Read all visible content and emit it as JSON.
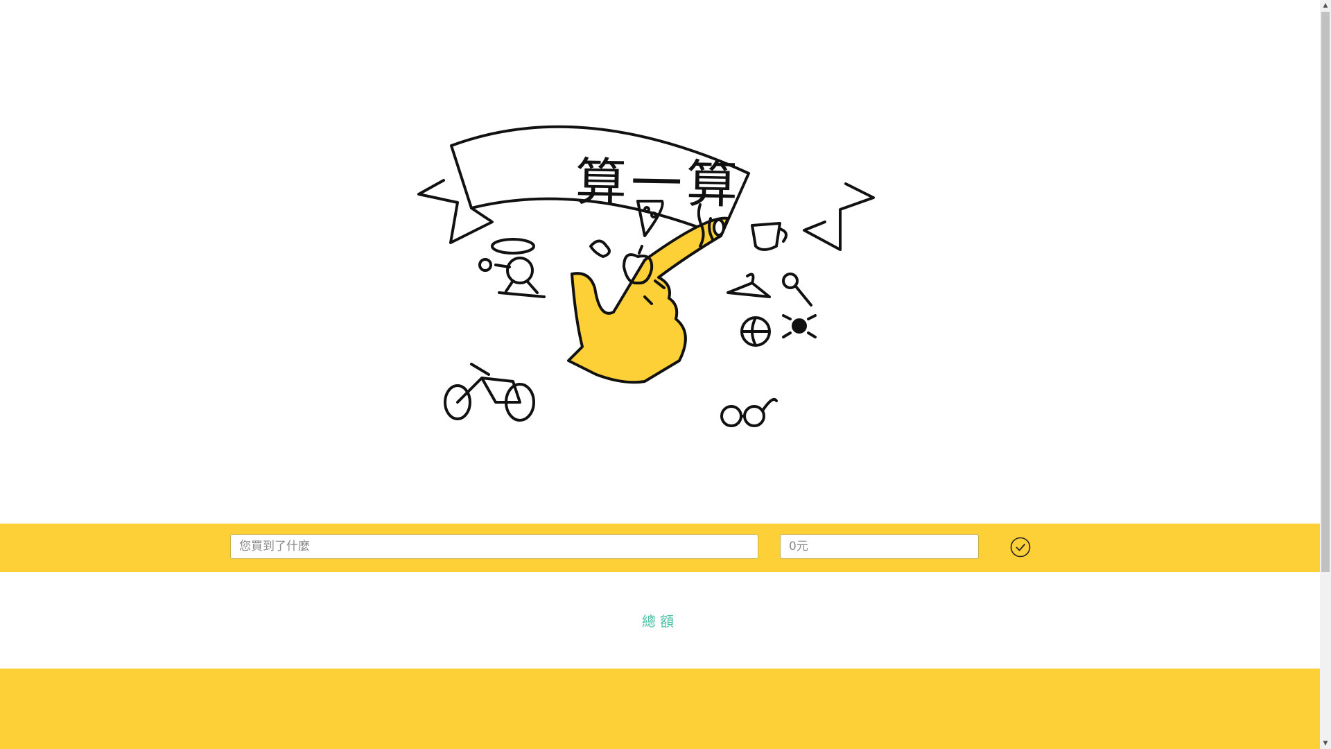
{
  "hero": {
    "title": "算一算"
  },
  "form": {
    "item_placeholder": "您買到了什麼",
    "amount_placeholder": "0元",
    "confirm_icon": "check-circle-icon"
  },
  "summary": {
    "total_label": "總額"
  },
  "colors": {
    "accent_yellow": "#fdd037",
    "total_text": "#4ec3a8"
  }
}
